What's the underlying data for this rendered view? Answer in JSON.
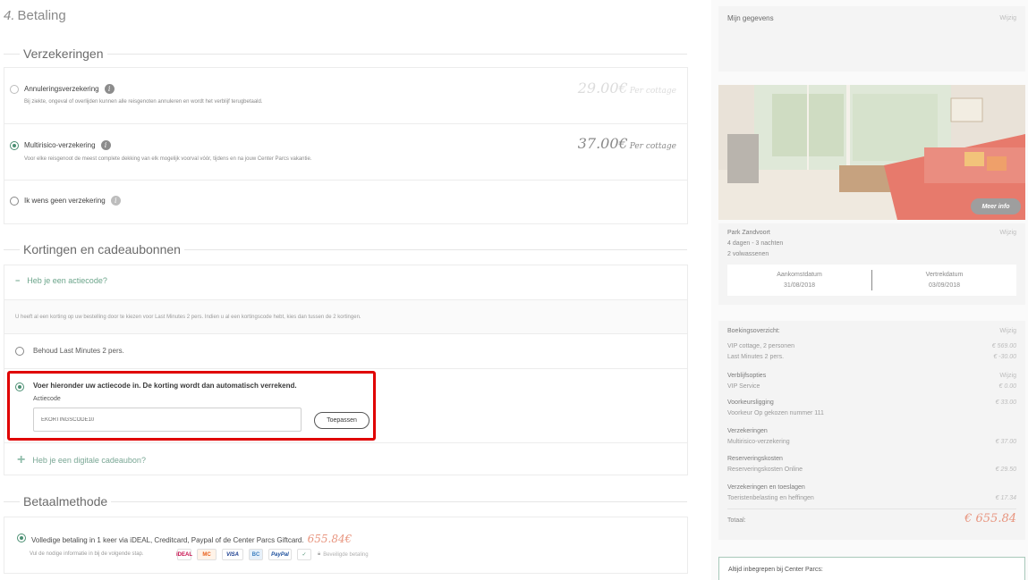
{
  "step": {
    "number": "4.",
    "title": "Betaling"
  },
  "insurance": {
    "heading": "Verzekeringen",
    "options": [
      {
        "label": "Annuleringsverzekering",
        "desc": "Bij ziekte, ongeval of overlijden kunnen alle reisgenoten annuleren en wordt het verblijf terugbetaald.",
        "price": "29.00€",
        "unit": "Per cottage",
        "selected": false
      },
      {
        "label": "Multirisico-verzekering",
        "desc": "Voor elke reisgenoot de meest complete dekking van elk mogelijk voorval vóór, tijdens en na jouw Center Parcs vakantie.",
        "price": "37.00€",
        "unit": "Per cottage",
        "selected": true
      },
      {
        "label": "Ik wens geen verzekering",
        "selected": false
      }
    ]
  },
  "discounts": {
    "heading": "Kortingen en cadeaubonnen",
    "actiecode_toggle": "Heb je een actiecode?",
    "note": "U heeft al een korting op uw bestelling door te kiezen voor Last Minutes 2 pers.  Indien u al een kortingscode hebt, kies dan tussen de 2 kortingen.",
    "option_keep": "Behoud Last Minutes 2 pers.",
    "option_code": "Voer hieronder uw actiecode in. De korting wordt dan automatisch verrekend.",
    "code_label": "Actiecode",
    "code_value": "EKORTINGSCODE10",
    "apply": "Toepassen",
    "giftcard_toggle": "Heb je een digitale cadeaubon?"
  },
  "payment": {
    "heading": "Betaalmethode",
    "option": "Volledige betaling in 1 keer via iDEAL, Creditcard, Paypal of de Center Parcs Giftcard.",
    "amount": "655.84€",
    "desc": "Vul de nodige informatie in bij de volgende stap.",
    "logos": [
      "iDEAL",
      "MC",
      "VISA",
      "BC",
      "PayPal",
      "✓"
    ],
    "secure": "Beveiligde betaling"
  },
  "sidebar": {
    "mijn_gegevens": "Mijn gegevens",
    "edit": "Wijzig",
    "meer_info": "Meer info",
    "park": "Park Zandvoort",
    "duration": "4 dagen - 3 nachten",
    "guests": "2 volwassenen",
    "arrival_label": "Aankomstdatum",
    "arrival": "31/08/2018",
    "departure_label": "Vertrekdatum",
    "departure": "03/09/2018",
    "overview": "Boekingsoverzicht:",
    "lines": [
      {
        "label": "VIP cottage, 2 personen",
        "value": "€ 569.00"
      },
      {
        "label": "Last Minutes 2 pers.",
        "value": "€ -30.00"
      }
    ],
    "verblijf": "Verblijfsopties",
    "vip_service": "VIP Service",
    "vip_value": "€ 0.00",
    "voorkeur": "Voorkeursligging",
    "voorkeur_item": "Voorkeur Op gekozen nummer 111",
    "voorkeur_value": "€ 33.00",
    "verz": "Verzekeringen",
    "verz_item": "Multirisico-verzekering",
    "verz_value": "€ 37.00",
    "res": "Reserveringskosten",
    "res_item": "Reserveringskosten Online",
    "res_value": "€ 29.50",
    "toeslag": "Verzekeringen en toeslagen",
    "toeslag_item": "Toeristenbelasting en heffingen",
    "toeslag_value": "€ 17.34",
    "total_label": "Totaal:",
    "total": "€ 655.84",
    "always": "Altijd inbegrepen bij Center Parcs:"
  }
}
